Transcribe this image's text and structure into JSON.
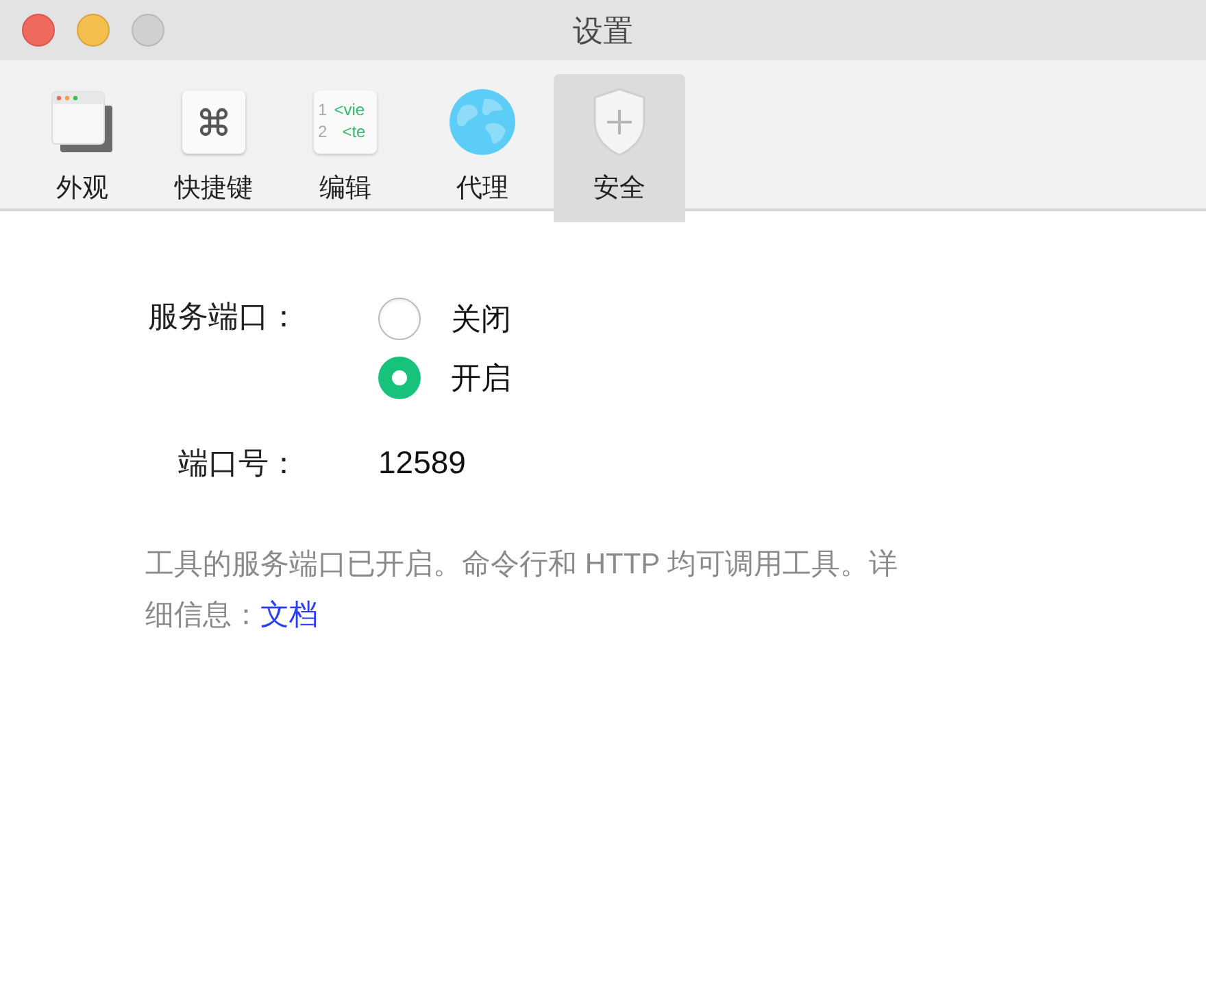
{
  "window": {
    "title": "设置",
    "controls": [
      {
        "kind": "close"
      },
      {
        "kind": "minimize"
      },
      {
        "kind": "inactive"
      }
    ]
  },
  "tabs": [
    {
      "label": "外观",
      "kind": "window",
      "selected": false
    },
    {
      "label": "快捷键",
      "kind": "command",
      "selected": false
    },
    {
      "label": "编辑",
      "kind": "editor",
      "selected": false,
      "icon_lines": [
        {
          "number": "1",
          "code": "<vie"
        },
        {
          "number": "2",
          "code": "<te"
        }
      ]
    },
    {
      "label": "代理",
      "kind": "globe",
      "selected": false
    },
    {
      "label": "安全",
      "kind": "shield",
      "selected": true
    }
  ],
  "service_port": {
    "label": "服务端口：",
    "options": [
      {
        "label": "关闭",
        "selected": false
      },
      {
        "label": "开启",
        "selected": true
      }
    ]
  },
  "port": {
    "label": "端口号：",
    "value": "12589"
  },
  "description": {
    "text": "工具的服务端口已开启。命令行和 HTTP 均可调用工具。详细信息：",
    "link": "文档"
  }
}
